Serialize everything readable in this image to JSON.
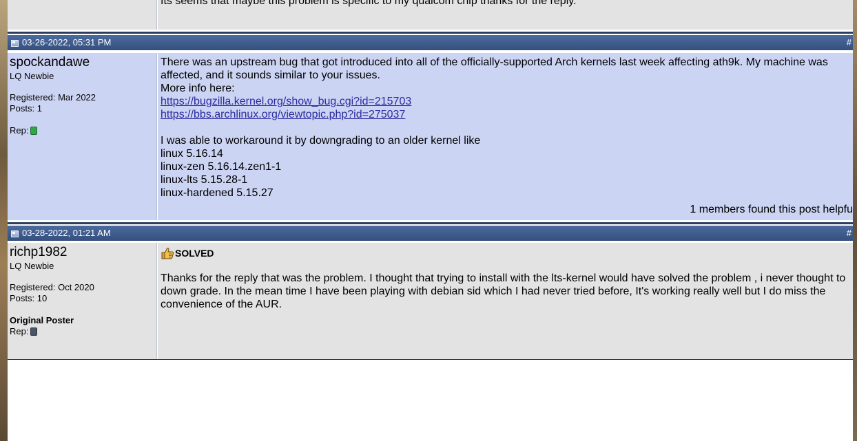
{
  "top_post": {
    "message_fragment": "Its seems that maybe this problem is specific to my qualcom chip thanks for the reply."
  },
  "posts": [
    {
      "header": {
        "date": "03-26-2022, 05:31 PM",
        "post_number": "#"
      },
      "user": {
        "username": "spockandawe",
        "title": "LQ Newbie",
        "registered": "Registered: Mar 2022",
        "posts": "Posts: 1",
        "rep_label": "Rep:",
        "rep_color": "#2fa84a"
      },
      "message": {
        "line1": "There was an upstream bug that got introduced into all of the officially-supported Arch kernels last week affecting ath9k. My machine was affected, and it sounds similar to your issues.",
        "line2": "More info here:",
        "link1": "https://bugzilla.kernel.org/show_bug.cgi?id=215703",
        "link2": "https://bbs.archlinux.org/viewtopic.php?id=275037",
        "line3": "I was able to workaround it by downgrading to an older kernel like",
        "k1": "linux 5.16.14",
        "k2": "linux-zen 5.16.14.zen1-1",
        "k3": "linux-lts 5.15.28-1",
        "k4": "linux-hardened 5.15.27"
      },
      "helpful": "1 members found this post helpfu"
    },
    {
      "header": {
        "date": "03-28-2022, 01:21 AM",
        "post_number": "#"
      },
      "user": {
        "username": "richp1982",
        "title": "LQ Newbie",
        "registered": "Registered: Oct 2020",
        "posts": "Posts: 10",
        "original_poster": "Original Poster",
        "rep_label": "Rep:",
        "rep_color": "#4a5566"
      },
      "message": {
        "icon": "thumbs-up-icon",
        "solved": "SOLVED",
        "body": "Thanks for the reply that was the problem. I thought that trying to install with the lts-kernel would have solved the problem , i never thought to down grade. In the mean time I have been playing with debian sid which I had never tried before, It's working really well but I do miss the convenience of the AUR."
      }
    }
  ]
}
